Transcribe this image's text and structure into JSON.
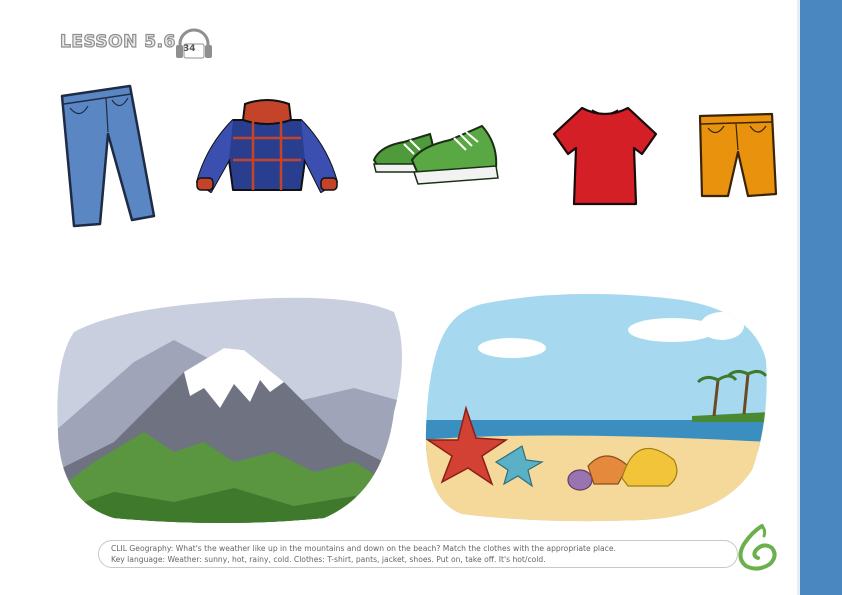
{
  "header": {
    "lesson": "LESSON 5.6",
    "track_number": "34"
  },
  "clothes": [
    {
      "name": "jeans",
      "color": "#5b86c4"
    },
    {
      "name": "jacket",
      "color": "#2a3e8f"
    },
    {
      "name": "sneakers",
      "color": "#4f9a3a"
    },
    {
      "name": "t-shirt",
      "color": "#d41f26"
    },
    {
      "name": "shorts",
      "color": "#e8920e"
    }
  ],
  "scenes": [
    {
      "name": "mountain"
    },
    {
      "name": "beach"
    }
  ],
  "footer": {
    "line1": "CLIL Geography: What's the weather like up in the mountains and down on the beach? Match the clothes with the appropriate place.",
    "line2": "Key language: Weather: sunny, hot, rainy, cold. Clothes: T-shirt, pants, jacket, shoes. Put on, take off. It's hot/cold."
  },
  "colors": {
    "side_bar": "#4a86c0",
    "logo": "#6ab04c"
  }
}
